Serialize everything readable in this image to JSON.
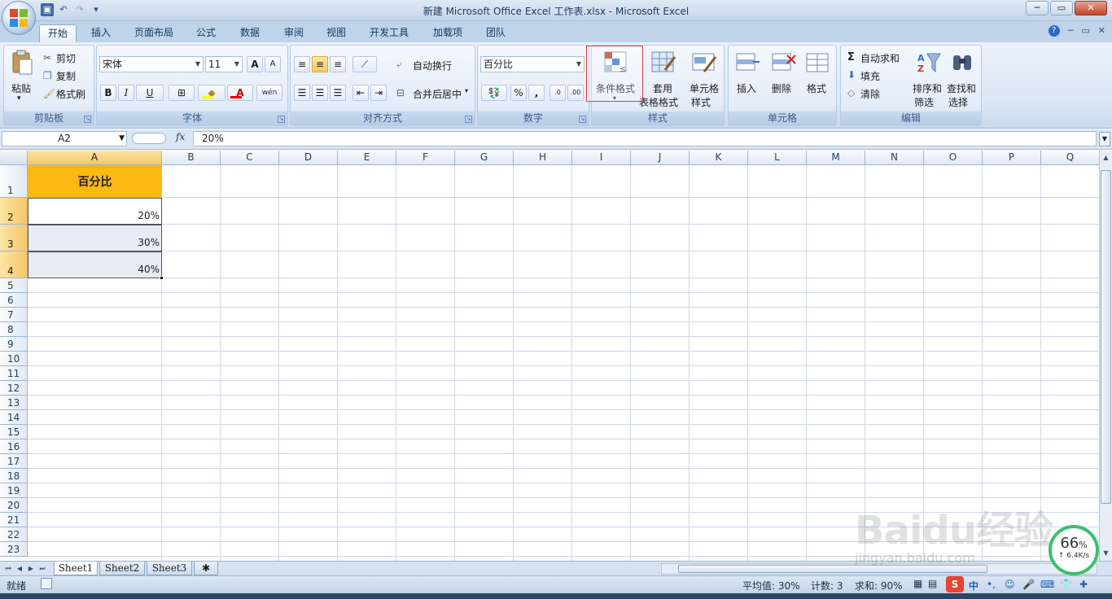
{
  "window": {
    "title": "新建 Microsoft Office Excel 工作表.xlsx - Microsoft Excel",
    "minimize": "─",
    "maximize": "▭",
    "close": "✕"
  },
  "tabs": [
    {
      "label": "开始",
      "active": true
    },
    {
      "label": "插入"
    },
    {
      "label": "页面布局"
    },
    {
      "label": "公式"
    },
    {
      "label": "数据"
    },
    {
      "label": "审阅"
    },
    {
      "label": "视图"
    },
    {
      "label": "开发工具"
    },
    {
      "label": "加载项"
    },
    {
      "label": "团队"
    }
  ],
  "ribbon": {
    "clipboard": {
      "label": "剪贴板",
      "paste": "粘贴",
      "cut": "剪切",
      "copy": "复制",
      "format_painter": "格式刷"
    },
    "font": {
      "label": "字体",
      "font_name": "宋体",
      "font_size": "11",
      "grow": "A",
      "shrink": "A",
      "bold": "B",
      "italic": "I",
      "underline": "U",
      "font_color_letter": "A",
      "phonetic": "wén"
    },
    "alignment": {
      "label": "对齐方式",
      "wrap_text": "自动换行",
      "merge_center": "合并后居中"
    },
    "number": {
      "label": "数字",
      "format": "百分比",
      "percent": "%",
      "comma": ","
    },
    "styles": {
      "label": "样式",
      "conditional_formatting": "条件格式",
      "format_as_table_1": "套用",
      "format_as_table_2": "表格格式",
      "cell_styles_1": "单元格",
      "cell_styles_2": "样式"
    },
    "cells": {
      "label": "单元格",
      "insert": "插入",
      "delete": "删除",
      "format": "格式"
    },
    "editing": {
      "label": "编辑",
      "autosum": "自动求和",
      "fill": "填充",
      "clear": "清除",
      "sort_filter_1": "排序和",
      "sort_filter_2": "筛选",
      "find_select_1": "查找和",
      "find_select_2": "选择"
    }
  },
  "formula_bar": {
    "name_box": "A2",
    "fx": "fx",
    "content": "20%"
  },
  "columns": [
    "A",
    "B",
    "C",
    "D",
    "E",
    "F",
    "G",
    "H",
    "I",
    "J",
    "K",
    "L",
    "M",
    "N",
    "O",
    "P",
    "Q"
  ],
  "rows": [
    "1",
    "2",
    "3",
    "4",
    "5",
    "6",
    "7",
    "8",
    "9",
    "10",
    "11",
    "12",
    "13",
    "14",
    "15",
    "16",
    "17",
    "18",
    "19",
    "20",
    "21",
    "22",
    "23"
  ],
  "cells": {
    "A1": "百分比",
    "A2": "20%",
    "A3": "30%",
    "A4": "40%"
  },
  "colors": {
    "header_fill": "#fdb814",
    "alt_row_fill": "#e8ebf5",
    "highlight_box": "#e03a3a"
  },
  "sheets": [
    "Sheet1",
    "Sheet2",
    "Sheet3"
  ],
  "status": {
    "mode": "就绪",
    "average": "平均值: 30%",
    "count": "计数: 3",
    "sum": "求和: 90%"
  },
  "overlay": {
    "watermark": "Baidu经验",
    "watermark_url": "jingyan.baidu.com",
    "speed_percent": "66",
    "speed_unit": "%",
    "speed_rate": "↑ 6.4K/s"
  }
}
